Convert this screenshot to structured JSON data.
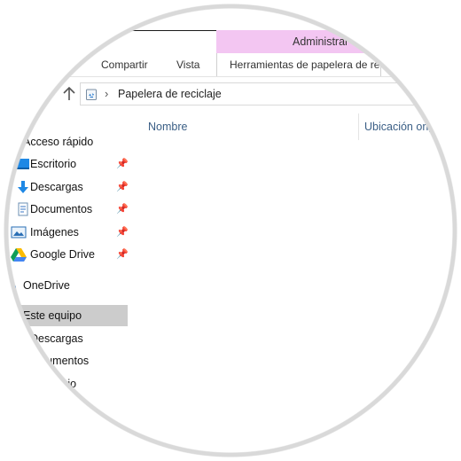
{
  "ribbon": {
    "context_header": "Administrar",
    "tabs": [
      "Compartir",
      "Vista",
      "Herramientas de papelera de reciclaje"
    ]
  },
  "address_bar": {
    "path": "Papelera de reciclaje"
  },
  "columns": {
    "name": "Nombre",
    "location": "Ubicación original"
  },
  "navigation": {
    "quick_access": "Acceso rápido",
    "quick_items": [
      {
        "label": "Escritorio",
        "icon": "desktop-icon",
        "pinned": true
      },
      {
        "label": "Descargas",
        "icon": "download-icon",
        "pinned": true
      },
      {
        "label": "Documentos",
        "icon": "documents-icon",
        "pinned": true
      },
      {
        "label": "Imágenes",
        "icon": "pictures-icon",
        "pinned": true
      },
      {
        "label": "Google Drive",
        "icon": "google-drive-icon",
        "pinned": true
      }
    ],
    "onedrive": "OneDrive",
    "this_pc": "Este equipo",
    "this_pc_items": [
      "Descargas",
      "Documentos",
      "Escritorio"
    ]
  },
  "colors": {
    "context_tab": "#f3c6f2",
    "selected_nav": "#cccccc",
    "column_header_text": "#3a5e85",
    "accent_blue": "#1e88e5"
  }
}
